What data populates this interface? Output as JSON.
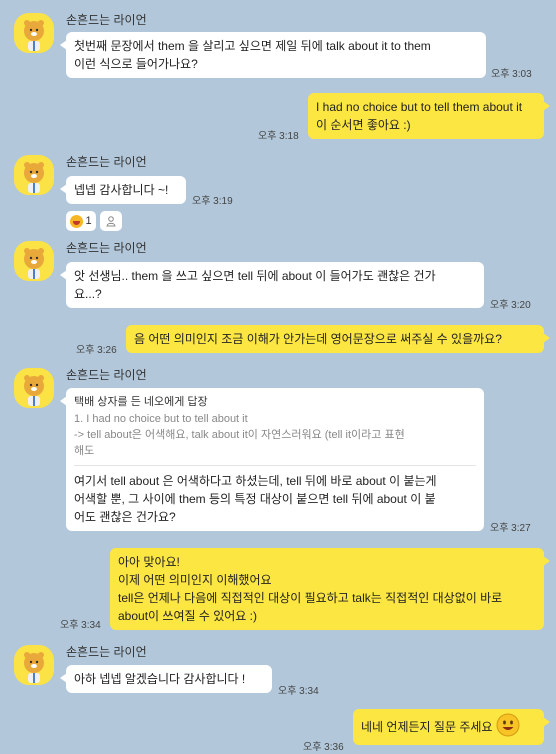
{
  "chat": {
    "sender_name": "손흔드는 라이언",
    "messages": [
      {
        "text": "첫번째 문장에서 them 을 살리고 싶으면 제일 뒤에 talk about it to them\n이런 식으로 들어가나요?",
        "time": "오후 3:03"
      },
      {
        "text": "I had no choice but to tell them about it\n이 순서면 좋아요 :)",
        "time": "오후 3:18"
      },
      {
        "text": "넵넵 감사합니다 ~!",
        "time": "오후 3:19"
      },
      {
        "text": "앗 선생님.. them 을 쓰고 싶으면 tell 뒤에 about 이 들어가도 괜찮은 건가\n요...?",
        "time": "오후 3:20"
      },
      {
        "text": "음 어떤 의미인지 조금 이해가 안가는데 영어문장으로 써주실 수 있을까요?",
        "time": "오후 3:26"
      },
      {
        "reply_header": "택배 상자를 든 네오에게 답장",
        "reply_quote": "1. I had no choice but to tell about it\n-> tell about은 어색해요, talk about it이 자연스러워요 (tell it이라고 표현\n해도",
        "text": "여기서 tell about 은 어색하다고 하셨는데, tell 뒤에 바로 about 이 붙는게\n어색할 뿐, 그 사이에 them 등의 특정 대상이 붙으면 tell 뒤에 about 이 붙\n어도 괜찮은 건가요?",
        "time": "오후 3:27"
      },
      {
        "text": "아아 맞아요!\n이제 어떤 의미인지 이해했어요\ntell은 언제나 다음에 직접적인 대상이 필요하고 talk는 직접적인 대상없이 바로\nabout이 쓰여질 수 있어요 :)",
        "time": "오후 3:34"
      },
      {
        "text": "아하 넵넵 알겠습니다 감사합니다 !",
        "time": "오후 3:34"
      },
      {
        "text": "네네 언제든지 질문 주세요",
        "time": "오후 3:36"
      }
    ],
    "reaction": {
      "count": "1",
      "icon": "laughing-emoji-icon"
    },
    "colors": {
      "background": "#b2c7da",
      "my_bubble": "#fce642",
      "their_bubble": "#ffffff",
      "avatar_bg": "#fbe245"
    }
  }
}
